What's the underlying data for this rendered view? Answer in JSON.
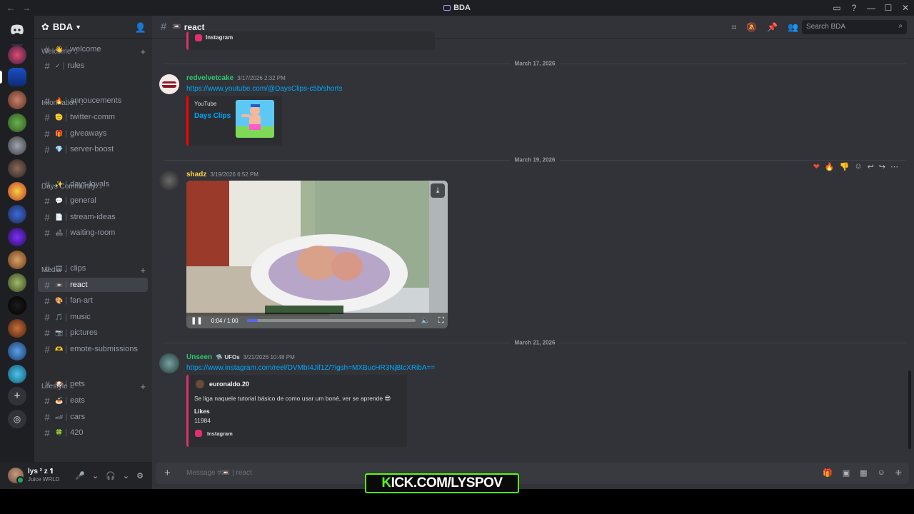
{
  "window": {
    "title": "BDA",
    "nav": [
      "←",
      "→"
    ],
    "controls": [
      "—",
      "☐",
      "✕"
    ]
  },
  "server": {
    "name": "BDA"
  },
  "categories": [
    {
      "name": "Welcome",
      "channels": [
        {
          "label": "welcome",
          "emoji": "👋"
        },
        {
          "label": "rules",
          "emoji": "✓"
        }
      ]
    },
    {
      "name": "Information",
      "channels": [
        {
          "label": "annoucements",
          "emoji": "🔥"
        },
        {
          "label": "twitter-comm",
          "emoji": "🫡"
        },
        {
          "label": "giveaways",
          "emoji": "🎁"
        },
        {
          "label": "server-boost",
          "emoji": "💎"
        }
      ]
    },
    {
      "name": "Days Community",
      "channels": [
        {
          "label": "days-loyals",
          "emoji": "✨"
        },
        {
          "label": "general",
          "emoji": "💬"
        },
        {
          "label": "stream-ideas",
          "emoji": "📄"
        },
        {
          "label": "waiting-room",
          "emoji": "🛋"
        }
      ]
    },
    {
      "name": "Media",
      "channels": [
        {
          "label": "clips",
          "emoji": "🎞"
        },
        {
          "label": "react",
          "emoji": "📼"
        },
        {
          "label": "fan-art",
          "emoji": "🎨"
        },
        {
          "label": "music",
          "emoji": "🎵"
        },
        {
          "label": "pictures",
          "emoji": "📷"
        },
        {
          "label": "emote-submissions",
          "emoji": "🫶"
        }
      ]
    },
    {
      "name": "Lifestyle",
      "channels": [
        {
          "label": "pets",
          "emoji": "🐶"
        },
        {
          "label": "eats",
          "emoji": "🍝"
        },
        {
          "label": "cars",
          "emoji": "🏎"
        },
        {
          "label": "420",
          "emoji": "🍀"
        }
      ]
    }
  ],
  "user": {
    "name": "lys ² z 𝟏",
    "status": "Juice WRLD"
  },
  "channel": {
    "name": "react"
  },
  "search": {
    "placeholder": "Search BDA"
  },
  "messages": [
    {
      "date": "March 17, 2026",
      "author": "redvelvetcake",
      "time": "3/17/2026 2:32 PM",
      "link": "https://www.youtube.com/@DaysClips-c5b/shorts",
      "embed": {
        "provider": "YouTube",
        "title": "Days Clips"
      }
    },
    {
      "date": "March 19, 2026",
      "author": "shadz",
      "time": "3/19/2026 6:52 PM",
      "video": {
        "time": "0:04 / 1:00",
        "progress": 0.067
      }
    },
    {
      "date": "March 21, 2026",
      "author": "Unseen",
      "tag": "UFOs",
      "time": "3/21/2026 10:48 PM",
      "link": "https://www.instagram.com/reel/DVMbI4Jif1Z/?igsh=MXBucHR3NjBtcXRibA==",
      "embed": {
        "account": "euronaldo.20",
        "text": "Se liga naquele tutorial básico de como usar um boné, ver se aprende 😎",
        "likes_label": "Likes",
        "likes": "11984",
        "footer": "Instagram"
      }
    }
  ],
  "top_embed_footer": "Instagram",
  "composer": {
    "placeholder": "Message #📼 | react"
  },
  "overlay": {
    "k": "K",
    "rest": "ICK.COM/LYSPOV"
  },
  "colors": {
    "accent": "#5865f2",
    "youtube": "#ff0000",
    "instagram": "#e1306c",
    "link": "#00a8fc",
    "author_green": "#2dc770"
  }
}
